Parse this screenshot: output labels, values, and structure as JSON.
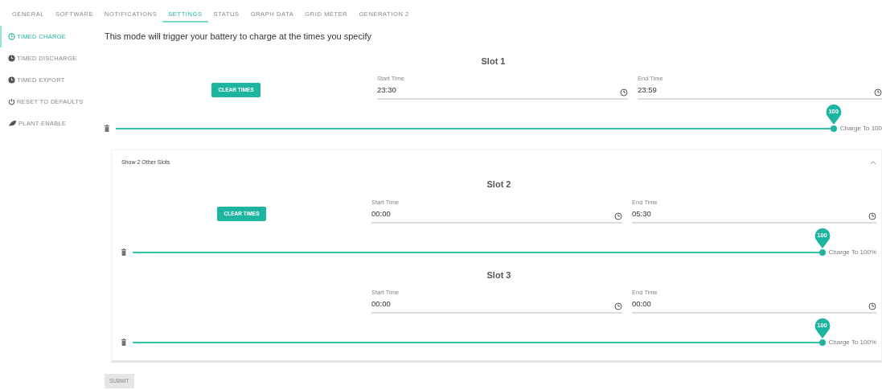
{
  "tabs": [
    {
      "label": "GENERAL",
      "selected": false
    },
    {
      "label": "SOFTWARE",
      "selected": false
    },
    {
      "label": "NOTIFICATIONS",
      "selected": false
    },
    {
      "label": "SETTINGS",
      "selected": true
    },
    {
      "label": "STATUS",
      "selected": false
    },
    {
      "label": "GRAPH DATA",
      "selected": false
    },
    {
      "label": "GRID METER",
      "selected": false
    },
    {
      "label": "GENERATION 2",
      "selected": false
    }
  ],
  "sidebar": {
    "items": [
      {
        "label": "TIMED CHARGE",
        "selected": true
      },
      {
        "label": "TIMED DISCHARGE",
        "selected": false
      },
      {
        "label": "TIMED EXPORT",
        "selected": false
      },
      {
        "label": "RESET TO DEFAULTS",
        "selected": false
      },
      {
        "label": "PLANT ENABLE",
        "selected": false
      }
    ]
  },
  "description": "This mode will trigger your battery to charge at the times you specify",
  "slots": [
    {
      "title": "Slot 1",
      "clear_button": "CLEAR TIMES",
      "start_label": "Start Time",
      "start_value": "23:30",
      "end_label": "End Time",
      "end_value": "23:59",
      "level": 1,
      "pin_label": "100",
      "charge_label": "Charge To 100"
    }
  ],
  "other_slots": {
    "label": "Show 2 Other Slots",
    "expanded": true,
    "slots": [
      {
        "title": "Slot 2",
        "clear_button": "CLEAR TIMES",
        "start_label": "Start Time",
        "start_value": "00:00",
        "end_label": "End Time",
        "end_value": "05:30",
        "level": 1,
        "pin_label": "100",
        "charge_label": "Charge To 100%"
      },
      {
        "title": "Slot 3",
        "start_label": "Start Time",
        "start_value": "00:00",
        "end_label": "End Time",
        "end_value": "00:00",
        "level": 1,
        "pin_label": "100",
        "charge_label": "Charge To 100%"
      }
    ]
  },
  "submit": {
    "label": "SUBMIT",
    "disabled": true
  }
}
